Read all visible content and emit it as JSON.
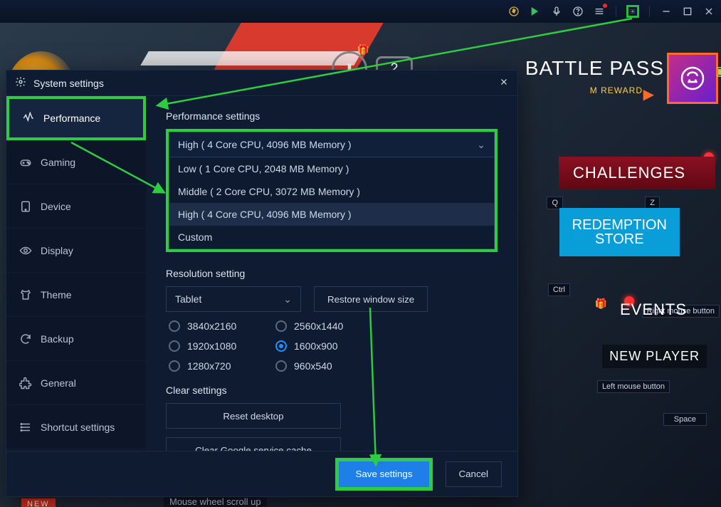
{
  "titlebar": {
    "icons": [
      "compass",
      "play",
      "mic",
      "help",
      "menu",
      "gear",
      "minimize",
      "maximize",
      "close"
    ]
  },
  "hud": {
    "battlepass": "BATTLE PASS",
    "battlepass_sub": "M REWARD",
    "challenges": "CHALLENGES",
    "redemption_line1": "REDEMPTION",
    "redemption_line2": "STORE",
    "events": "EVENTS",
    "newplayer": "NEW PLAYER",
    "key_q": "Q",
    "key_z": "Z",
    "key_ctrl": "Ctrl",
    "key_rmb": "Right mouse button",
    "key_lmb": "Left mouse button",
    "key_space": "Space",
    "new_badge": "NEW",
    "wheel_hint": "Mouse wheel scroll up",
    "download_count": "2"
  },
  "dialog": {
    "title": "System settings",
    "sidebar": {
      "items": [
        {
          "label": "Performance",
          "icon": "activity",
          "active": true
        },
        {
          "label": "Gaming",
          "icon": "gamepad"
        },
        {
          "label": "Device",
          "icon": "tablet"
        },
        {
          "label": "Display",
          "icon": "eye"
        },
        {
          "label": "Theme",
          "icon": "shirt"
        },
        {
          "label": "Backup",
          "icon": "refresh"
        },
        {
          "label": "General",
          "icon": "puzzle"
        },
        {
          "label": "Shortcut settings",
          "icon": "list"
        }
      ]
    },
    "perf": {
      "heading": "Performance settings",
      "selected": "High ( 4 Core CPU, 4096 MB Memory )",
      "options": [
        "Low ( 1 Core CPU, 2048 MB Memory )",
        "Middle ( 2 Core CPU, 3072 MB Memory )",
        "High ( 4 Core CPU, 4096 MB Memory )",
        "Custom"
      ]
    },
    "res": {
      "heading": "Resolution setting",
      "device": "Tablet",
      "restore": "Restore window size",
      "options": [
        "3840x2160",
        "2560x1440",
        "1920x1080",
        "1600x900",
        "1280x720",
        "960x540"
      ],
      "selected": "1600x900"
    },
    "clear": {
      "heading": "Clear settings",
      "reset": "Reset desktop",
      "cache": "Clear Google service cache"
    },
    "footer": {
      "save": "Save settings",
      "cancel": "Cancel"
    }
  }
}
